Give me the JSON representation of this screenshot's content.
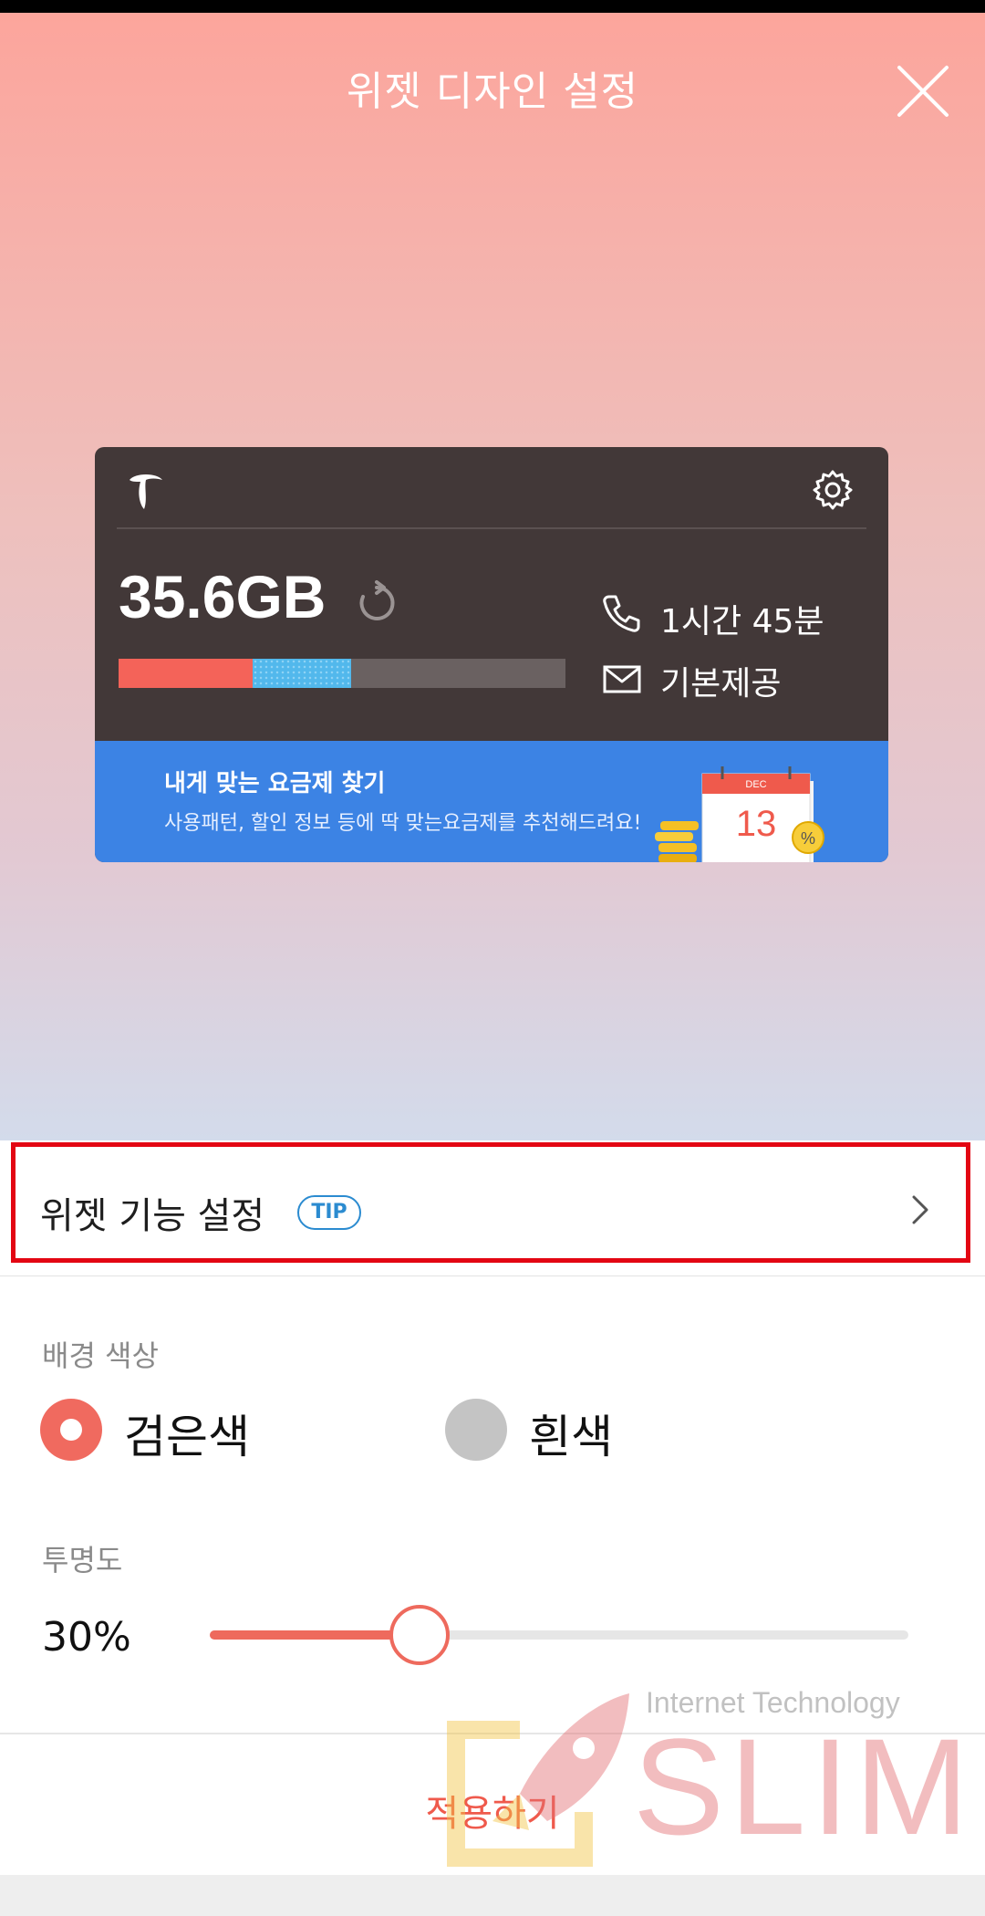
{
  "header": {
    "title": "위젯 디자인 설정",
    "close_icon": "close-icon"
  },
  "widget": {
    "logo_icon": "t-logo-icon",
    "settings_icon": "gear-icon",
    "data_amount": "35.6GB",
    "refresh_icon": "refresh-icon",
    "usage": {
      "red_fraction": 0.3,
      "blue_fraction": 0.22
    },
    "call_icon": "phone-icon",
    "call_time": "1시간 45분",
    "message_icon": "mail-icon",
    "message_text": "기본제공",
    "banner": {
      "title": "내게 맞는 요금제 찾기",
      "subtitle": "사용패턴, 할인 정보 등에 딱 맞는요금제를 추천해드려요!",
      "calendar_month": "DEC",
      "calendar_day": "13",
      "badge_symbol": "%"
    }
  },
  "feature_settings": {
    "label": "위젯 기능 설정",
    "tip_badge": "TIP",
    "chevron_icon": "chevron-right-icon",
    "highlight_color": "#e30613"
  },
  "background_color": {
    "label": "배경 색상",
    "options": [
      {
        "label": "검은색",
        "selected": true
      },
      {
        "label": "흰색",
        "selected": false
      }
    ]
  },
  "opacity": {
    "label": "투명도",
    "value_text": "30%",
    "value": 0.3
  },
  "apply_button": {
    "label": "적용하기"
  },
  "watermark": {
    "small_text": "Internet Technology",
    "big_text": "SLIM"
  },
  "colors": {
    "accent": "#ee6a5d",
    "widget_bg": "#423838",
    "banner_bg": "#3c83e4"
  }
}
